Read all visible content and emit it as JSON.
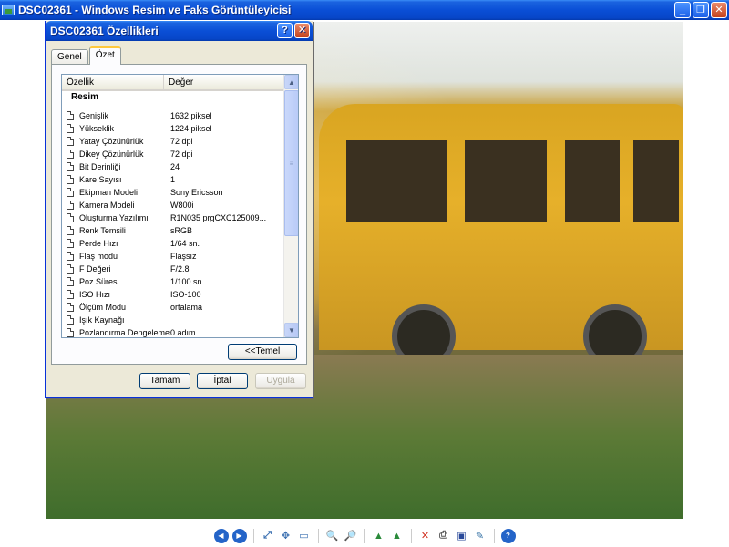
{
  "window": {
    "title": "DSC02361 - Windows Resim ve Faks Görüntüleyicisi",
    "min_icon": "minimize-icon",
    "restore_icon": "restore-icon",
    "close_icon": "close-icon"
  },
  "dialog": {
    "title": "DSC02361 Özellikleri",
    "help_glyph": "?",
    "close_glyph": "✕",
    "tabs": [
      {
        "label": "Genel",
        "active": false
      },
      {
        "label": "Özet",
        "active": true
      }
    ],
    "columns": {
      "property": "Özellik",
      "value": "Değer"
    },
    "group": "Resim",
    "rows": [
      {
        "name": "Genişlik",
        "value": "1632 piksel"
      },
      {
        "name": "Yükseklik",
        "value": "1224 piksel"
      },
      {
        "name": "Yatay Çözünürlük",
        "value": "72 dpi"
      },
      {
        "name": "Dikey Çözünürlük",
        "value": "72 dpi"
      },
      {
        "name": "Bit Derinliği",
        "value": "24"
      },
      {
        "name": "Kare Sayısı",
        "value": "1"
      },
      {
        "name": "Ekipman Modeli",
        "value": "Sony Ericsson"
      },
      {
        "name": "Kamera Modeli",
        "value": "W800i"
      },
      {
        "name": "Oluşturma Yazılımı",
        "value": "R1N035      prgCXC125009..."
      },
      {
        "name": "Renk Temsili",
        "value": "sRGB"
      },
      {
        "name": "Perde Hızı",
        "value": "1/64 sn."
      },
      {
        "name": "Flaş modu",
        "value": "Flaşsız"
      },
      {
        "name": "F Değeri",
        "value": "F/2.8"
      },
      {
        "name": "Poz Süresi",
        "value": "1/100 sn."
      },
      {
        "name": "ISO Hızı",
        "value": "ISO-100"
      },
      {
        "name": "Ölçüm Modu",
        "value": "ortalama"
      },
      {
        "name": "Işık Kaynağı",
        "value": ""
      },
      {
        "name": "Pozlandırma Dengelemesi",
        "value": "0 adım"
      }
    ],
    "buttons": {
      "basic": "<<Temel",
      "ok": "Tamam",
      "cancel": "İptal",
      "apply": "Uygula"
    }
  },
  "toolbar": [
    {
      "name": "previous-image-icon",
      "glyph": "◀"
    },
    {
      "name": "next-image-icon",
      "glyph": "▶"
    },
    {
      "name": "best-fit-icon",
      "glyph": "⤢"
    },
    {
      "name": "actual-size-icon",
      "glyph": "✥"
    },
    {
      "name": "slideshow-icon",
      "glyph": "▭"
    },
    {
      "name": "zoom-in-icon",
      "glyph": "🔍"
    },
    {
      "name": "zoom-out-icon",
      "glyph": "🔎"
    },
    {
      "name": "rotate-clockwise-icon",
      "glyph": "▲"
    },
    {
      "name": "rotate-counterclockwise-icon",
      "glyph": "▲"
    },
    {
      "name": "delete-icon",
      "glyph": "✕"
    },
    {
      "name": "print-icon",
      "glyph": "⎙"
    },
    {
      "name": "save-icon",
      "glyph": "▣"
    },
    {
      "name": "edit-icon",
      "glyph": "✎"
    },
    {
      "name": "help-icon",
      "glyph": "?"
    }
  ]
}
